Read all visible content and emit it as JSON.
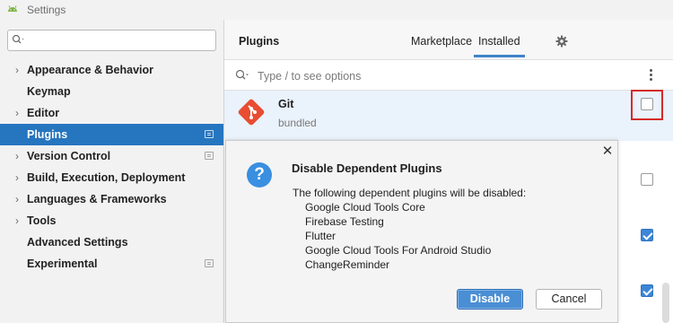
{
  "window": {
    "title": "Settings",
    "icon": "android-icon"
  },
  "sidebar": {
    "search": {
      "value": "",
      "placeholder": ""
    },
    "items": [
      {
        "label": "Appearance & Behavior",
        "expandable": true,
        "badge": false
      },
      {
        "label": "Keymap",
        "expandable": false,
        "badge": false
      },
      {
        "label": "Editor",
        "expandable": true,
        "badge": false
      },
      {
        "label": "Plugins",
        "expandable": false,
        "badge": true,
        "selected": true
      },
      {
        "label": "Version Control",
        "expandable": true,
        "badge": true
      },
      {
        "label": "Build, Execution, Deployment",
        "expandable": true,
        "badge": false
      },
      {
        "label": "Languages & Frameworks",
        "expandable": true,
        "badge": false
      },
      {
        "label": "Tools",
        "expandable": true,
        "badge": false
      },
      {
        "label": "Advanced Settings",
        "expandable": false,
        "badge": false
      },
      {
        "label": "Experimental",
        "expandable": false,
        "badge": true
      }
    ]
  },
  "plugins": {
    "title": "Plugins",
    "tabs": [
      "Marketplace",
      "Installed"
    ],
    "active_tab": "Installed",
    "search_placeholder": "Type / to see options",
    "items": [
      {
        "name": "Git",
        "subtitle": "bundled",
        "enabled": false
      }
    ],
    "other_checkboxes": [
      false,
      true,
      true
    ]
  },
  "dialog": {
    "title": "Disable Dependent Plugins",
    "message": "The following dependent plugins will be disabled:",
    "plugins": [
      "Google Cloud Tools Core",
      "Firebase Testing",
      "Flutter",
      "Google Cloud Tools For Android Studio",
      "ChangeReminder"
    ],
    "primary_button": "Disable",
    "secondary_button": "Cancel"
  },
  "colors": {
    "selection": "#2675bf",
    "accent": "#4083c9",
    "git_brand": "#e84d31",
    "highlight_box": "#d62a2a",
    "checkbox_checked": "#3d86d6"
  }
}
